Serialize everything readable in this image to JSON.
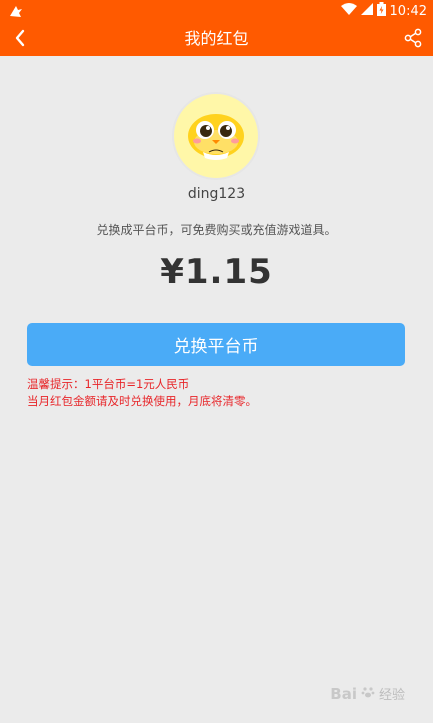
{
  "statusbar": {
    "time": "10:42",
    "notification_icon": "bird-notification-icon",
    "wifi_icon": "wifi-icon",
    "signal_icon": "signal-icon",
    "battery_icon": "battery-icon"
  },
  "header": {
    "title": "我的红包",
    "back_icon": "back-arrow-icon",
    "share_icon": "share-icon",
    "color": "#ff5a00"
  },
  "profile": {
    "username": "ding123",
    "avatar_icon": "cartoon-chick-avatar"
  },
  "description": "兑换成平台币，可免费购买或充值游戏道具。",
  "balance": "¥1.15",
  "exchange_button": {
    "label": "兑换平台币",
    "color": "#4aabf7"
  },
  "tips": {
    "line1": "温馨提示：1平台币=1元人民币",
    "line2": "当月红包金额请及时兑换使用，月底将清零。",
    "color": "#e8262a"
  },
  "watermark": {
    "logo": "Bai",
    "text": "经验"
  }
}
